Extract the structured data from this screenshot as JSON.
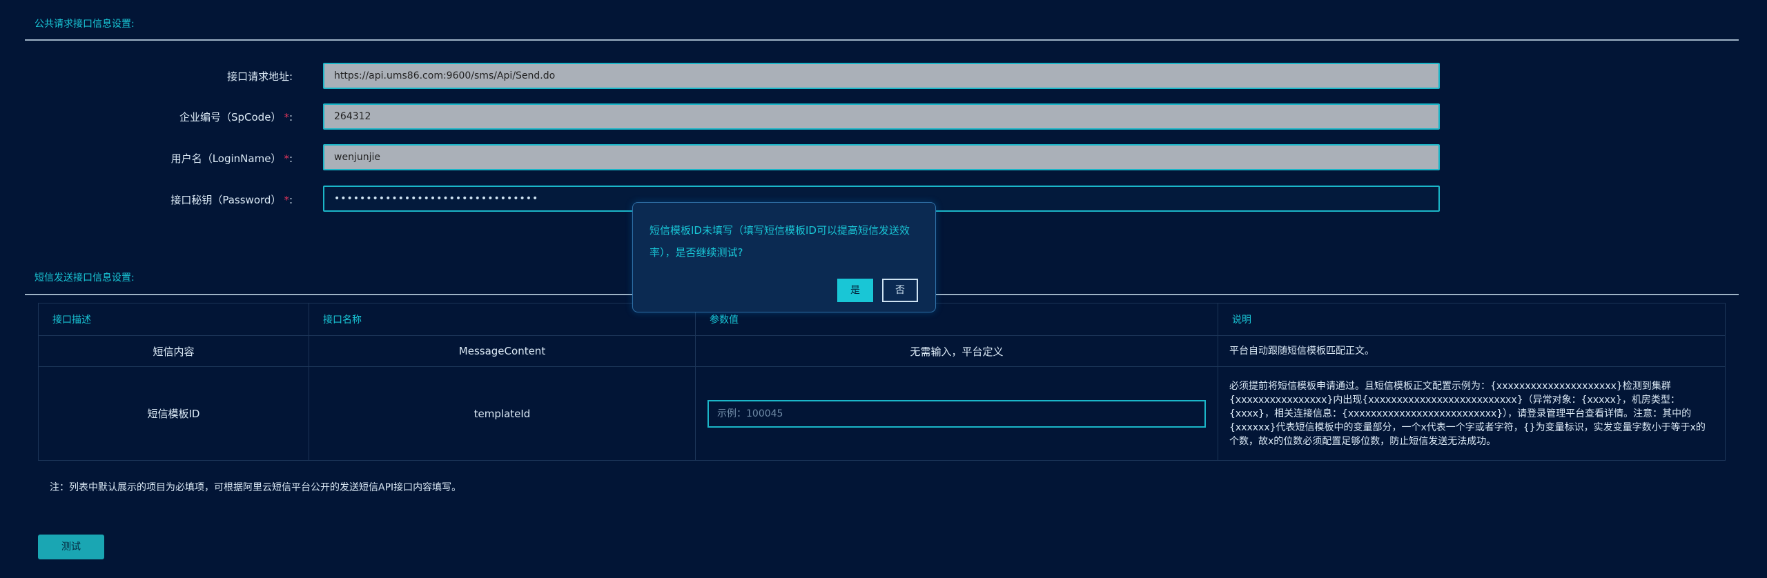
{
  "public_section": {
    "title": "公共请求接口信息设置:"
  },
  "form": {
    "fields": [
      {
        "label": "接口请求地址:",
        "required": false,
        "value": "https://api.ums86.com:9600/sms/Api/Send.do"
      },
      {
        "label": "企业编号（SpCode）",
        "required": true,
        "value": "264312"
      },
      {
        "label": "用户名（LoginName）",
        "required": true,
        "value": "wenjunjie"
      },
      {
        "label": "接口秘钥（Password）",
        "required": true,
        "value": "••••••••••••••••••••••••••••••••"
      }
    ],
    "required_mark": "*",
    "colon": ":"
  },
  "sms_section": {
    "title": "短信发送接口信息设置:"
  },
  "table": {
    "headers": [
      "接口描述",
      "接口名称",
      "参数值",
      "说明"
    ],
    "rows": [
      {
        "desc": "短信内容",
        "name": "MessageContent",
        "value": "无需输入，平台定义",
        "note": "平台自动跟随短信模板匹配正文。"
      },
      {
        "desc": "短信模板ID",
        "name": "templateId",
        "placeholder": "示例：100045",
        "note": "必须提前将短信模板申请通过。且短信模板正文配置示例为：{xxxxxxxxxxxxxxxxxxxxx}检测到集群{xxxxxxxxxxxxxxxx}内出现{xxxxxxxxxxxxxxxxxxxxxxxxxx}（异常对象：{xxxxx}，机房类型：{xxxx}，相关连接信息：{xxxxxxxxxxxxxxxxxxxxxxxxxx}），请登录管理平台查看详情。注意：其中的{xxxxxx}代表短信模板中的变量部分，一个x代表一个字或者字符，{}为变量标识，实发变量字数小于等于x的个数，故x的位数必须配置足够位数，防止短信发送无法成功。"
      }
    ]
  },
  "note": "注：列表中默认展示的项目为必填项，可根据阿里云短信平台公开的发送短信API接口内容填写。",
  "test_button": "测试",
  "dialog": {
    "message": "短信模板ID未填写（填写短信模板ID可以提高短信发送效率），是否继续测试?",
    "yes": "是",
    "no": "否"
  }
}
